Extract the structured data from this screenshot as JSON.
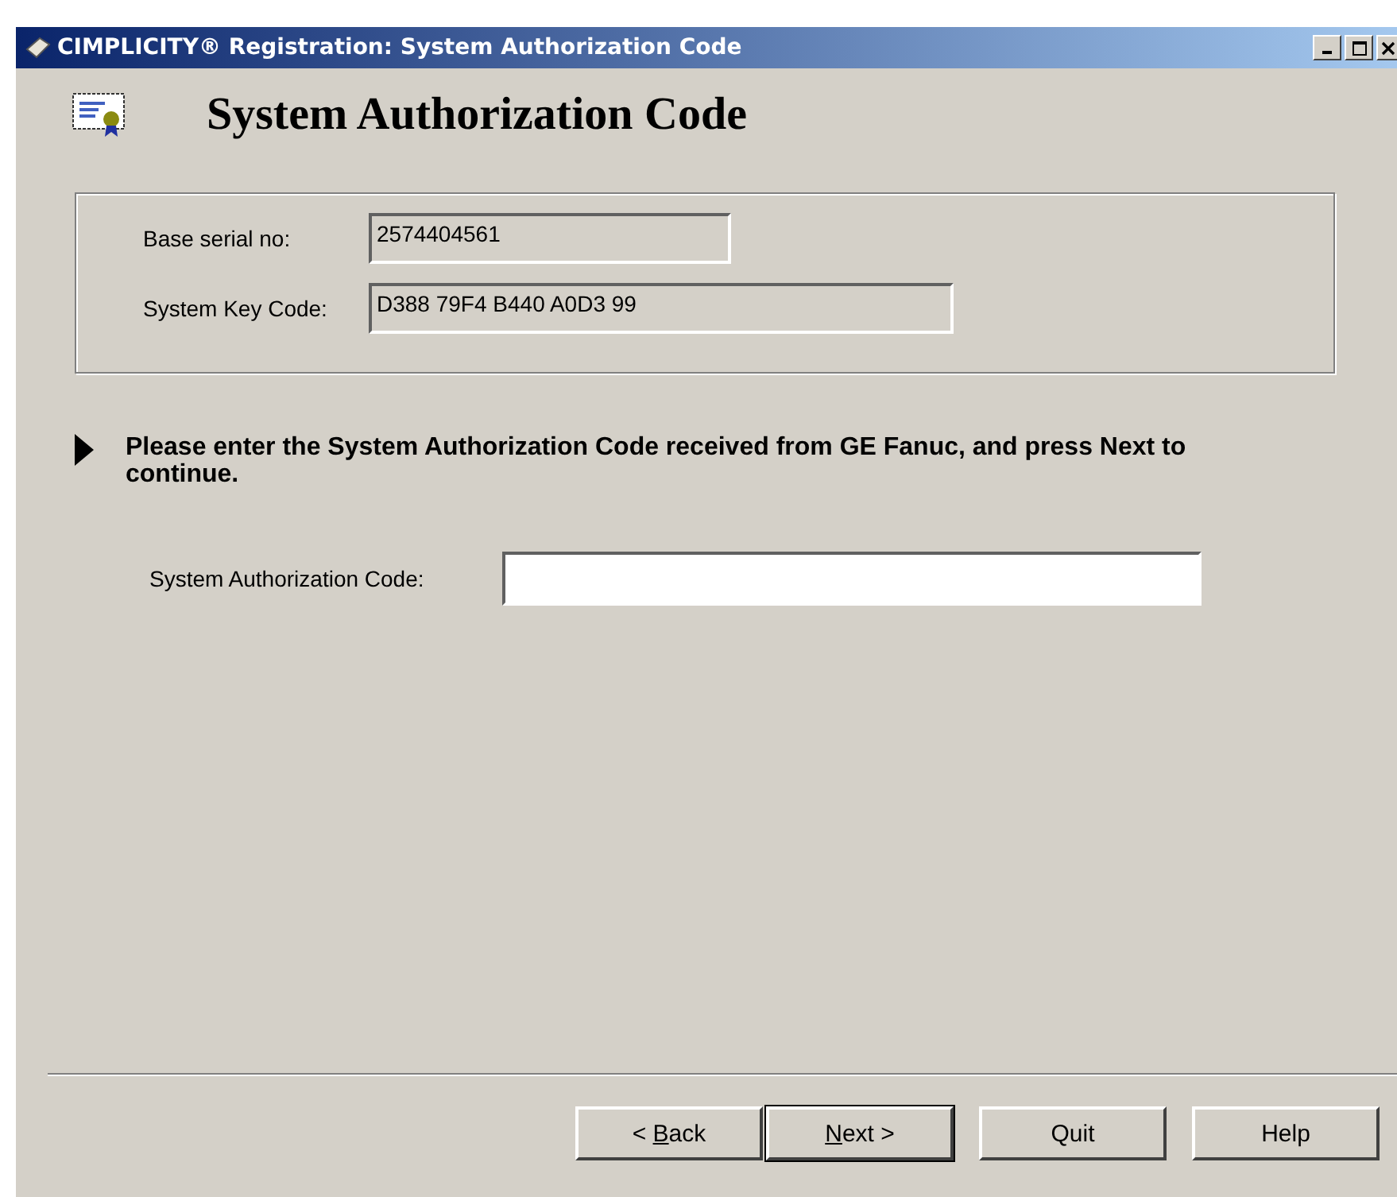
{
  "window": {
    "title": "CIMPLICITY® Registration: System Authorization Code"
  },
  "heading": "System Authorization Code",
  "info": [
    {
      "label": "Base serial no:",
      "value": "2574404561",
      "kind": "short"
    },
    {
      "label": "System Key Code:",
      "value": "D388 79F4 B440 A0D3 99",
      "kind": "long"
    }
  ],
  "instruction": "Please enter the System Authorization Code received from GE Fanuc, and press Next to continue.",
  "auth_field": {
    "label": "System Authorization Code:"
  },
  "buttons": [
    {
      "pre": "< ",
      "key": "B",
      "post": "ack",
      "default": false
    },
    {
      "key": "N",
      "post": "ext >",
      "default": true
    },
    {
      "pre": "Quit",
      "default": false
    },
    {
      "pre": "Help",
      "default": false
    }
  ]
}
